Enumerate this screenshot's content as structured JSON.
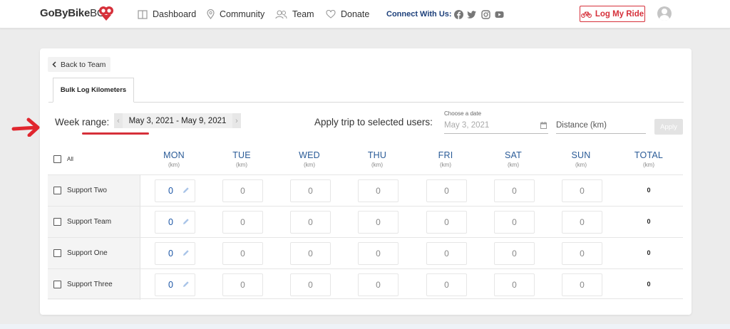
{
  "brand": {
    "logo_main": "GoByBike",
    "logo_suffix": "BC",
    "accent_color": "#d6303a",
    "link_color": "#2a5b97"
  },
  "nav": {
    "items": [
      {
        "label": "Dashboard",
        "icon": "book-icon"
      },
      {
        "label": "Community",
        "icon": "map-pin-icon"
      },
      {
        "label": "Team",
        "icon": "users-icon"
      },
      {
        "label": "Donate",
        "icon": "heart-icon"
      }
    ],
    "connect_label": "Connect With Us:",
    "social_icons": [
      "facebook-icon",
      "twitter-icon",
      "instagram-icon",
      "youtube-icon"
    ],
    "log_ride_label": "Log My Ride"
  },
  "page": {
    "back_label": "Back to Team",
    "tab_label": "Bulk Log Kilometers",
    "week_range_label": "Week range:",
    "week_range_value": "May 3, 2021 - May 9, 2021",
    "apply_trip_label": "Apply trip to selected users:",
    "date_caption": "Choose a date",
    "date_value": "May 3, 2021",
    "distance_placeholder": "Distance (km)",
    "apply_button": "Apply"
  },
  "table": {
    "all_label": "All",
    "unit": "(km)",
    "days": [
      "MON",
      "TUE",
      "WED",
      "THU",
      "FRI",
      "SAT",
      "SUN",
      "TOTAL"
    ],
    "rows": [
      {
        "name": "Support Two",
        "values": [
          "0",
          "0",
          "0",
          "0",
          "0",
          "0",
          "0"
        ],
        "total": "0"
      },
      {
        "name": "Support Team",
        "values": [
          "0",
          "0",
          "0",
          "0",
          "0",
          "0",
          "0"
        ],
        "total": "0"
      },
      {
        "name": "Support One",
        "values": [
          "0",
          "0",
          "0",
          "0",
          "0",
          "0",
          "0"
        ],
        "total": "0"
      },
      {
        "name": "Support Three",
        "values": [
          "0",
          "0",
          "0",
          "0",
          "0",
          "0",
          "0"
        ],
        "total": "0"
      }
    ]
  }
}
